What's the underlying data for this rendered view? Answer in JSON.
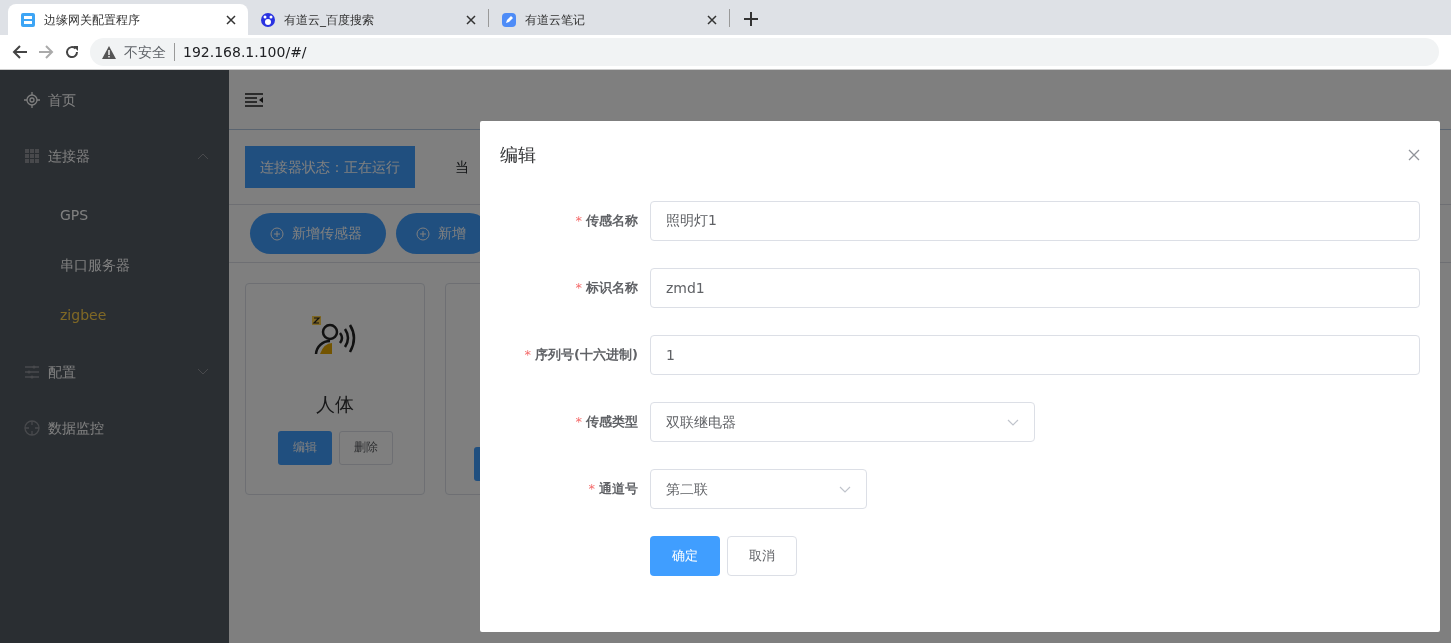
{
  "browser": {
    "tabs": [
      {
        "title": "边缘网关配置程序",
        "selected": true
      },
      {
        "title": "有道云_百度搜索",
        "selected": false
      },
      {
        "title": "有道云笔记",
        "selected": false
      }
    ],
    "security": "不安全",
    "url": "192.168.1.100/#/"
  },
  "sidebar": {
    "items": [
      {
        "label": "首页",
        "selected": false
      },
      {
        "label": "连接器",
        "expanded": true,
        "selected": false,
        "children": [
          {
            "label": "GPS",
            "selected": false
          },
          {
            "label": "串口服务器",
            "selected": false
          },
          {
            "label": "zigbee",
            "selected": true
          }
        ]
      },
      {
        "label": "配置",
        "expanded": false,
        "selected": false
      },
      {
        "label": "数据监控",
        "selected": false
      }
    ]
  },
  "main": {
    "status": "连接器状态：正在运行",
    "status_note": "当",
    "actions": [
      "新增传感器",
      "新增"
    ],
    "cards": [
      {
        "title": "人体",
        "buttons": [
          "编辑",
          "删除"
        ]
      }
    ]
  },
  "dialog": {
    "title": "编辑",
    "fields": [
      {
        "kind": "input",
        "required_mark": "*",
        "label": "传感名称",
        "value": "照明灯1"
      },
      {
        "kind": "input",
        "required_mark": "*",
        "label": "标识名称",
        "value": "zmd1"
      },
      {
        "kind": "input",
        "required_mark": "*",
        "label": "序列号(十六进制)",
        "value": "1"
      },
      {
        "kind": "select",
        "required_mark": "*",
        "label": "传感类型",
        "value": "双联继电器"
      },
      {
        "kind": "select",
        "required_mark": "*",
        "label": "通道号",
        "value": "第二联"
      }
    ],
    "buttons": [
      "确定",
      "取消"
    ]
  }
}
